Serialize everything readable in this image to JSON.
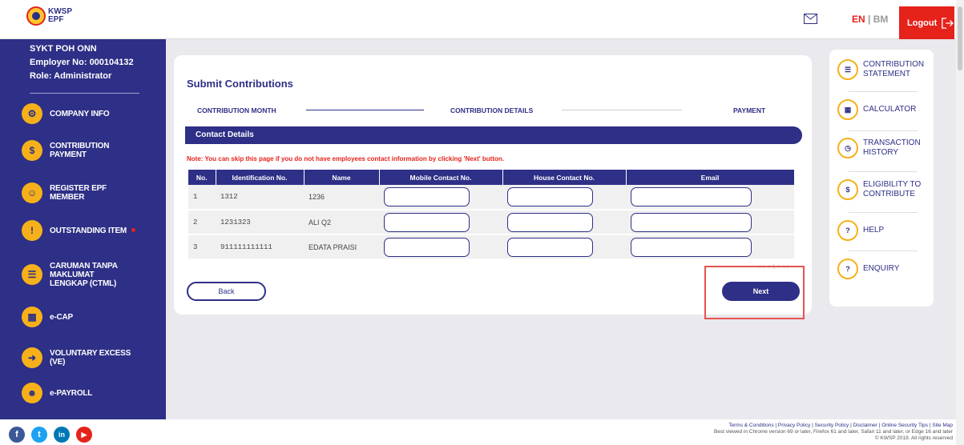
{
  "header": {
    "logo_line1": "KWSP",
    "logo_line2": "EPF",
    "lang_en": "EN",
    "lang_sep": " | ",
    "lang_bm": "BM",
    "logout": "Logout"
  },
  "employer": {
    "name": "SYKT POH ONN",
    "number": "Employer No: 000104132",
    "role": "Role: Administrator"
  },
  "sidebar": {
    "items": [
      {
        "label": "COMPANY INFO",
        "icon": "gear-icon"
      },
      {
        "label": "CONTRIBUTION PAYMENT",
        "icon": "payment-icon"
      },
      {
        "label": "REGISTER EPF MEMBER",
        "icon": "register-member-icon"
      },
      {
        "label": "OUTSTANDING ITEM",
        "icon": "outstanding-icon"
      },
      {
        "label": "CARUMAN TANPA MAKLUMAT LENGKAP (CTML)",
        "icon": "document-icon"
      },
      {
        "label": "e-CAP",
        "icon": "ecap-icon"
      },
      {
        "label": "VOLUNTARY EXCESS (VE)",
        "icon": "voluntary-icon"
      },
      {
        "label": "e-PAYROLL",
        "icon": "payroll-icon"
      }
    ]
  },
  "main": {
    "title": "Submit Contributions",
    "steps": [
      "CONTRIBUTION MONTH",
      "CONTRIBUTION DETAILS",
      "PAYMENT"
    ],
    "section": "Contact Details",
    "note": "Note: You can skip this page if you do not have employees contact information by clicking 'Next' button.",
    "columns": [
      "No.",
      "Identification No.",
      "Name",
      "Mobile Contact No.",
      "House Contact No.",
      "Email"
    ],
    "rows": [
      {
        "no": "1",
        "id": "1312",
        "name": "1236"
      },
      {
        "no": "2",
        "id": "1231323",
        "name": "ALI Q2"
      },
      {
        "no": "3",
        "id": "911111111111",
        "name": "EDATA PRAISI"
      }
    ],
    "pagination": "<< < 1 > >>",
    "back": "Back",
    "next": "Next"
  },
  "right_panel": {
    "items": [
      {
        "label": "CONTRIBUTION STATEMENT",
        "icon": "statement-icon"
      },
      {
        "label": "CALCULATOR",
        "icon": "calculator-icon"
      },
      {
        "label": "TRANSACTION HISTORY",
        "icon": "history-icon"
      },
      {
        "label": "ELIGIBILITY TO CONTRIBUTE",
        "icon": "eligibility-icon"
      },
      {
        "label": "HELP",
        "icon": "help-icon"
      },
      {
        "label": "ENQUIRY",
        "icon": "enquiry-icon"
      }
    ]
  },
  "footer": {
    "links": "Terms & Conditions | Privacy Policy | Security Policy | Disclaimer | Online Security Tips | Site Map",
    "browsers": "Best viewed in Chrome version 69 or later, Firefox 61 and later, Safari 11 and later, or Edge 16 and later",
    "copyright": "© KWSP 2019. All rights reserved",
    "social": [
      "f",
      "t",
      "in",
      "▶"
    ]
  },
  "colors": {
    "brand": "#2e2f86",
    "accent": "#e5231b",
    "icon": "#f6b11a"
  }
}
